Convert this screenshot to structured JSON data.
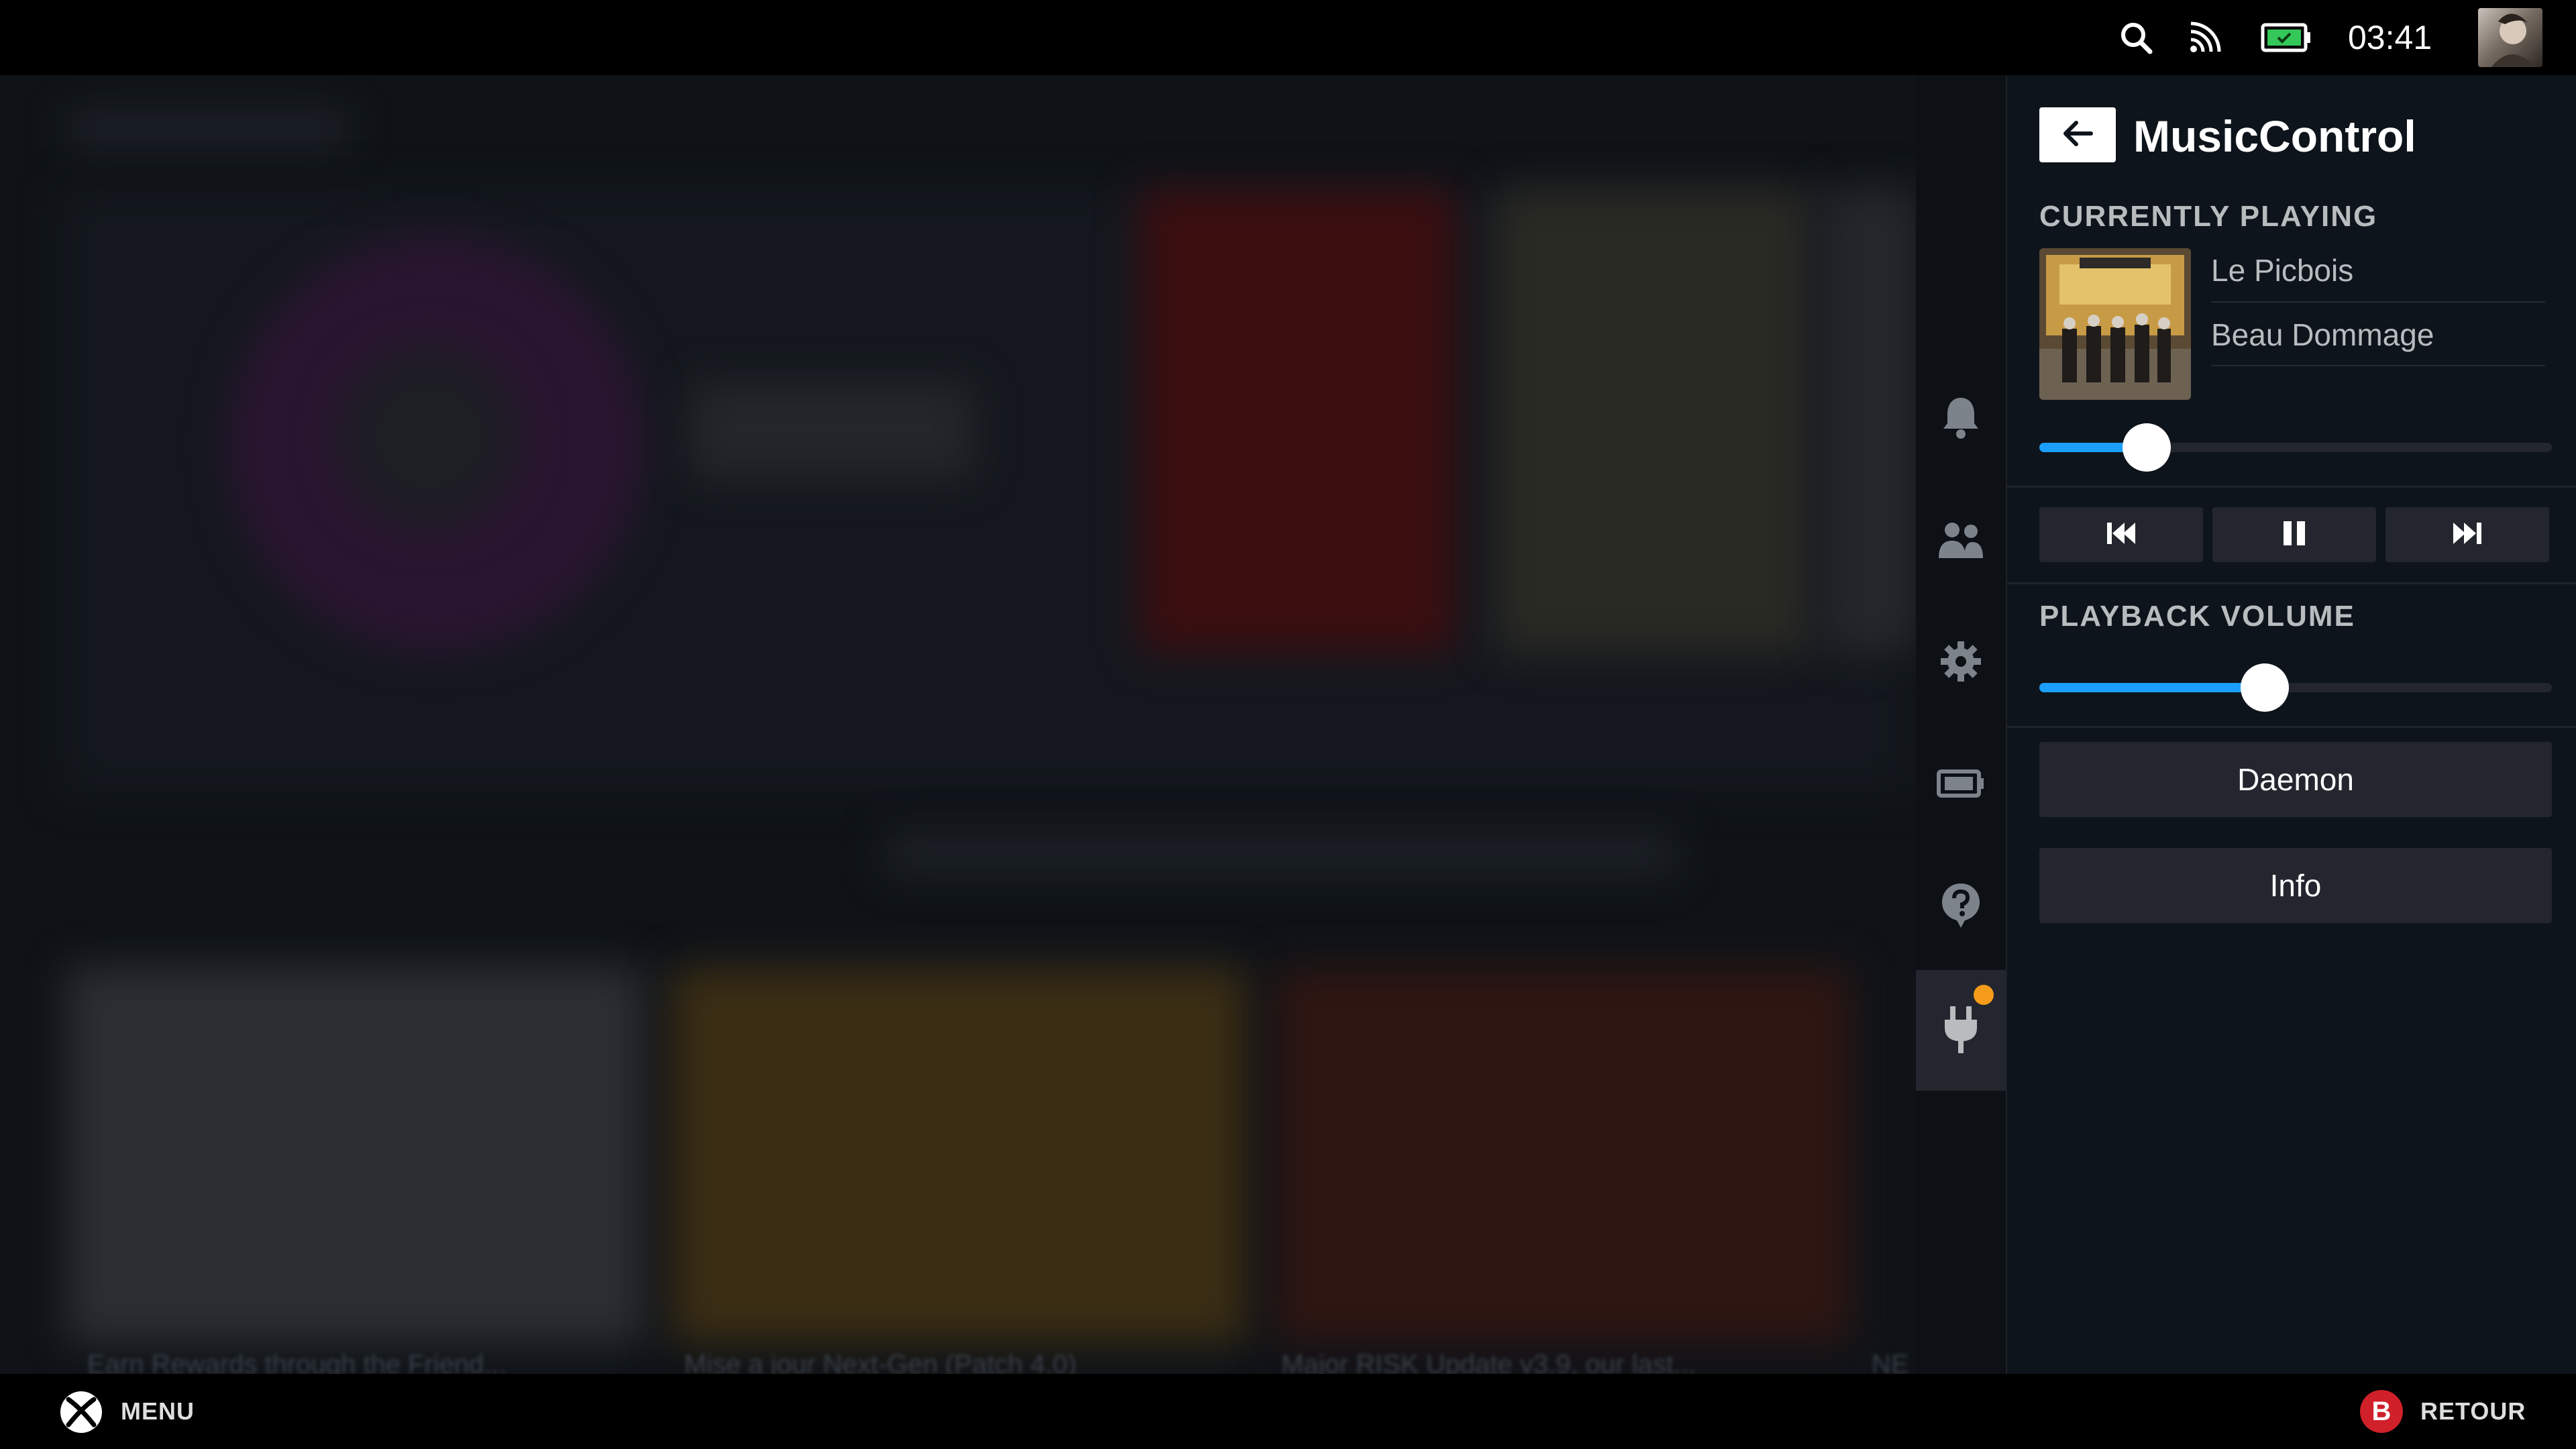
{
  "status_bar": {
    "time": "03:41",
    "icons": [
      "search-icon",
      "cast-icon",
      "battery-icon"
    ],
    "battery_color": "#34c759"
  },
  "background": {
    "cards": [
      "Earn Rewards through the Friend...",
      "Mise a jour Next-Gen (Patch 4.0)",
      "Major RISK Update v3.9, our last...",
      "NE"
    ]
  },
  "nav": {
    "items": [
      "bell-icon",
      "friends-icon",
      "gear-icon",
      "battery-icon",
      "help-icon",
      "plugin-icon"
    ],
    "active": "plugin-icon",
    "notification_color": "#f59c1a"
  },
  "panel": {
    "title": "MusicControl",
    "currently_playing_label": "CURRENTLY PLAYING",
    "track_title": "Le Picbois",
    "artist": "Beau Dommage",
    "progress": 0.21,
    "controls": [
      "previous-icon",
      "pause-icon",
      "next-icon"
    ],
    "volume_label": "PLAYBACK VOLUME",
    "volume": 0.44,
    "daemon_label": "Daemon",
    "info_label": "Info",
    "accent_color": "#1a9fff"
  },
  "bottom_bar": {
    "menu_label": "MENU",
    "back_label": "RETOUR",
    "back_key": "B",
    "back_key_color": "#d0202a"
  }
}
